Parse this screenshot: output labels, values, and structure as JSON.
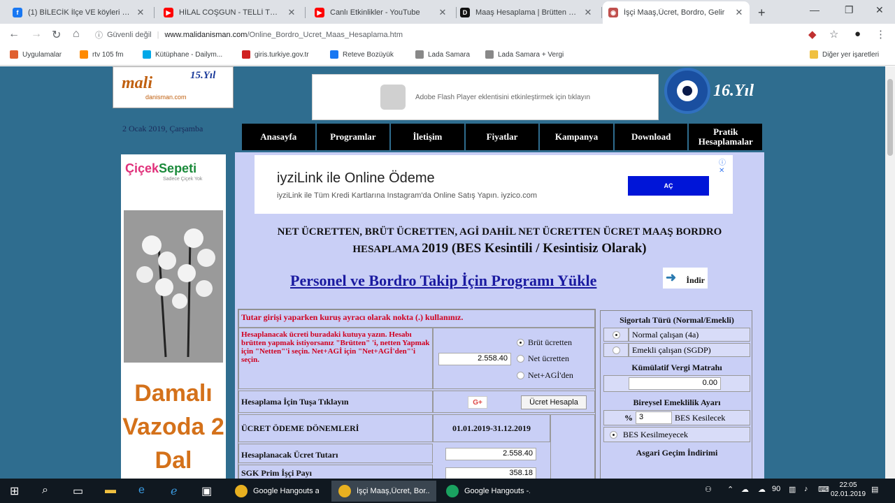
{
  "browser": {
    "tabs": [
      {
        "title": "(1) BİLECİK İlçe VE köyleri da...",
        "color": "#1877f2",
        "glyph": "f"
      },
      {
        "title": "HİLAL COŞGUN - TELLİ TURNA",
        "color": "#ff0000",
        "glyph": "▶"
      },
      {
        "title": "Canlı Etkinlikler - YouTube",
        "color": "#ff0000",
        "glyph": "▶"
      },
      {
        "title": "Maaş Hesaplama | Brütten Ne...",
        "color": "#111111",
        "glyph": "D"
      },
      {
        "title": "İşçi Maaş,Ücret, Bordro, Gelir",
        "color": "#c0504d",
        "glyph": "◉"
      }
    ],
    "address": {
      "security": "Güvenli değil",
      "domain": "www.malidanisman.com",
      "path": "/Online_Bordro_Ucret_Maas_Hesaplama.htm"
    },
    "bookmarks": [
      {
        "label": "Uygulamalar",
        "color": "#e06030"
      },
      {
        "label": "rtv 105 fm",
        "color": "#ff8a00"
      },
      {
        "label": "Kütüphane - Dailym...",
        "color": "#00a8e8"
      },
      {
        "label": "giris.turkiye.gov.tr",
        "color": "#d02020"
      },
      {
        "label": "Reteve Bozüyük",
        "color": "#1877f2"
      },
      {
        "label": "Lada Samara",
        "color": "#888888"
      },
      {
        "label": "Lada Samara + Vergi",
        "color": "#888888"
      }
    ],
    "other_bookmarks": "Diğer yer işaretleri"
  },
  "site": {
    "logo_main": "mali",
    "logo_year": "15.Yıl",
    "logo_sub": "danisman.com",
    "date": "2 Ocak 2019, Çarşamba",
    "flash_text": "Adobe Flash Player eklentisini etkinleştirmek için tıklayın",
    "year16": "16.Yıl",
    "nav": [
      "Anasayfa",
      "Programlar",
      "İletişim",
      "Fiyatlar",
      "Kampanya",
      "Download",
      "Pratik Hesaplamalar"
    ]
  },
  "leftad": {
    "brand_a": "Çiçek",
    "brand_b": "Sepeti",
    "tagline": "Sadece Çiçek Yok",
    "text": "Damalı Vazoda 2 Dal"
  },
  "ad": {
    "title": "iyziLink ile Online Ödeme",
    "subtitle": "iyziLink ile Tüm Kredi Kartlarına Instagram'da Online Satış Yapın. iyzico.com",
    "button": "AÇ",
    "close": "ⓘ ✕"
  },
  "main": {
    "heading_line1": "NET ÜCRETTEN, BRÜT ÜCRETTEN, AGİ DAHİL NET ÜCRETTEN ÜCRET MAAŞ BORDRO",
    "heading_line2a": "HESAPLAMA",
    "heading_line2b": "2019 (BES Kesintili / Kesintisiz Olarak)",
    "download_link": "Personel ve Bordro Takip İçin Programı Yükle",
    "download_btn": "İndir"
  },
  "form": {
    "notice": "Tutar girişi yaparken kuruş ayracı olarak nokta (.) kullanınız.",
    "instructions": "Hesaplanacak ücreti buradaki kutuya yazın. Hesabı brütten yapmak istiyorsanız \"Brütten\" 'i, netten Yapmak için \"Netten\"'i seçin. Net+AGİ için \"Net+AGİ'den\"'i seçin.",
    "amount": "2.558.40",
    "radio_brut": "Brüt ücretten",
    "radio_net": "Net ücretten",
    "radio_netagi": "Net+AGİ'den",
    "calc_label": "Hesaplama İçin Tuşa Tıklayın",
    "gplus": "G+",
    "calc_button": "Ücret Hesapla",
    "period_label": "ÜCRET ÖDEME DÖNEMLERİ",
    "period_value": "01.01.2019-31.12.2019",
    "wage_label": "Hesaplanacak Ücret Tutarı",
    "wage_value": "2.558.40",
    "sgk_label": "SGK Prim İşçi Payı",
    "sgk_value": "358.18"
  },
  "side": {
    "sigorta_title": "Sigortalı Türü (Normal/Emekli)",
    "normal": "Normal çalışan (4a)",
    "emekli": "Emekli çalışan (SGDP)",
    "kumulatif_title": "Kümülatif Vergi Matrahı",
    "kumulatif_value": "0.00",
    "bes_title": "Bireysel Emeklilik Ayarı",
    "bes_pct": "%",
    "bes_value": "3",
    "bes_kesilecek": "BES Kesilecek",
    "bes_kesilmeyecek": "BES Kesilmeyecek",
    "asgari": "Asgari Geçim İndirimi"
  },
  "taskbar": {
    "apps": [
      {
        "label": "Google Hangouts a...",
        "color": "#e8b020"
      },
      {
        "label": "İşçi Maaş,Ücret, Bor...",
        "color": "#e8b020"
      },
      {
        "label": "Google Hangouts -...",
        "color": "#1aa260"
      }
    ],
    "time": "22:05",
    "date": "02.01.2019",
    "tray_badge": "90"
  }
}
